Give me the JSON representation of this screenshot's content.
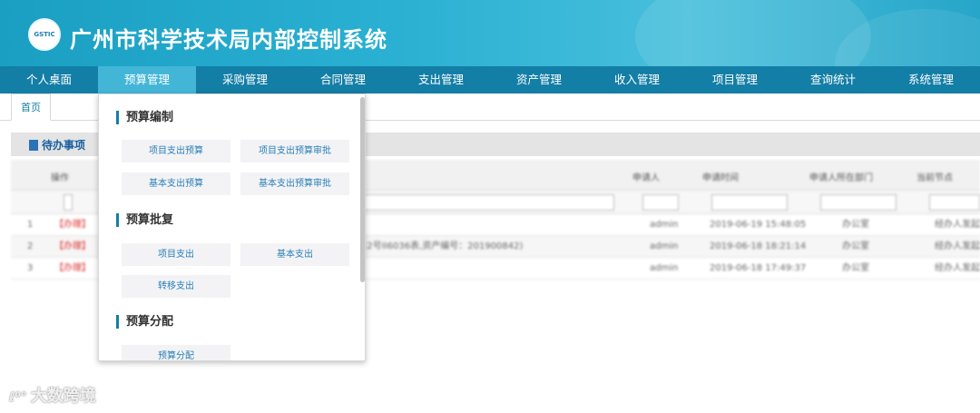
{
  "header": {
    "logo_text": "GSTIC",
    "title": "广州市科学技术局内部控制系统"
  },
  "nav": {
    "items": [
      {
        "label": "个人桌面"
      },
      {
        "label": "预算管理"
      },
      {
        "label": "采购管理"
      },
      {
        "label": "合同管理"
      },
      {
        "label": "支出管理"
      },
      {
        "label": "资产管理"
      },
      {
        "label": "收入管理"
      },
      {
        "label": "项目管理"
      },
      {
        "label": "查询统计"
      },
      {
        "label": "系统管理"
      }
    ],
    "active_index": 1
  },
  "tabs": {
    "home": "首页"
  },
  "panel": {
    "title": "待办事项"
  },
  "grid": {
    "headers": [
      "操作",
      "申请人",
      "申请时间",
      "申请人所在部门",
      "当前节点"
    ],
    "rows": [
      {
        "num": "1",
        "action": "【办理】",
        "desc": "",
        "applicant": "admin",
        "time": "2019-06-19 15:48:05",
        "dept": "办公室",
        "node": "经办人发起"
      },
      {
        "num": "2",
        "action": "【办理】",
        "desc": "12号II6036表,资产编号：201900842)",
        "applicant": "admin",
        "time": "2019-06-18 18:21:14",
        "dept": "办公室",
        "node": "经办人发起"
      },
      {
        "num": "3",
        "action": "【办理】",
        "desc": "",
        "applicant": "admin",
        "time": "2019-06-18 17:49:37",
        "dept": "办公室",
        "node": "经办人发起"
      }
    ]
  },
  "dropdown": {
    "sections": [
      {
        "title": "预算编制",
        "items": [
          "项目支出预算",
          "项目支出预算审批",
          "基本支出预算",
          "基本支出预算审批"
        ]
      },
      {
        "title": "预算批复",
        "items": [
          "项目支出",
          "基本支出",
          "转移支出"
        ]
      },
      {
        "title": "预算分配",
        "items": [
          "预算分配"
        ]
      }
    ]
  },
  "watermark": {
    "logo": "ℓ⁰°",
    "text": "大数跨境"
  },
  "colors": {
    "header": "#1a9fc3",
    "nav": "#137ea6",
    "nav_active": "#43b6d8",
    "accent_link": "#e03030"
  }
}
